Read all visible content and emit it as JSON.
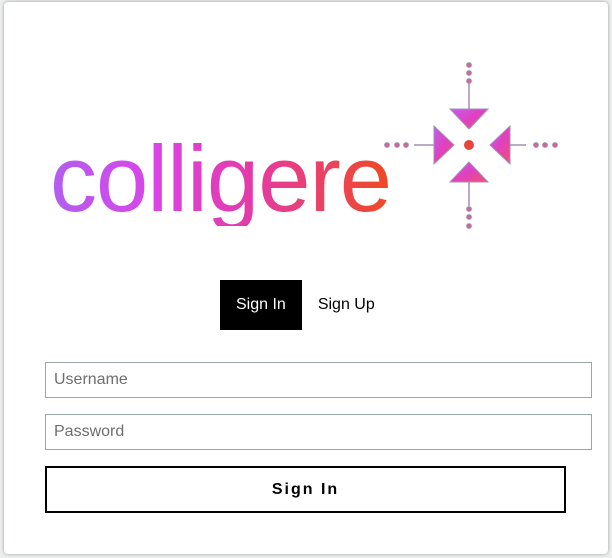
{
  "logo": {
    "wordmark": "colligere",
    "icon": "converging-arrows-icon",
    "colors": {
      "gradient_start": "#b25ff0",
      "gradient_mid": "#e53aa5",
      "gradient_end": "#ef4a20",
      "dots": "#c86a9a",
      "lines": "#a58fb6"
    }
  },
  "tabs": [
    {
      "label": "Sign In",
      "active": true
    },
    {
      "label": "Sign Up",
      "active": false
    }
  ],
  "form": {
    "username_placeholder": "Username",
    "username_value": "",
    "password_placeholder": "Password",
    "password_value": "",
    "submit_label": "Sign In"
  }
}
